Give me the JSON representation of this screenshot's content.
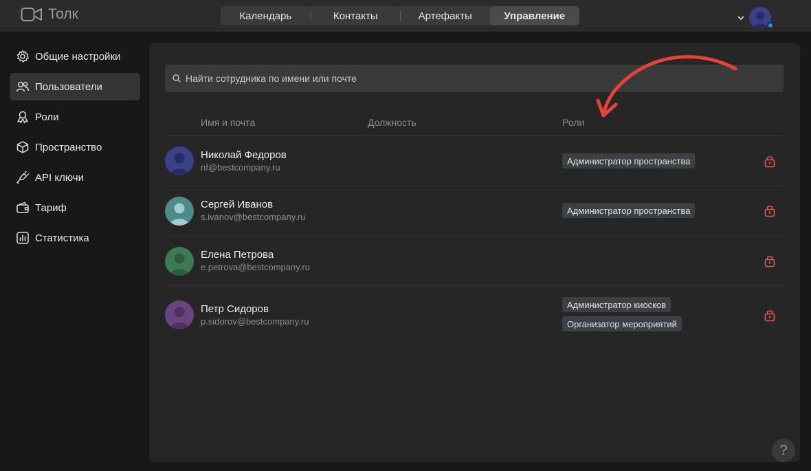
{
  "app": {
    "name": "Толк"
  },
  "nav": {
    "tabs": [
      "Календарь",
      "Контакты",
      "Артефакты",
      "Управление"
    ],
    "active": "Управление"
  },
  "sidebar": {
    "items": [
      {
        "label": "Общие настройки",
        "icon": "gear-icon"
      },
      {
        "label": "Пользователи",
        "icon": "users-icon",
        "active": true
      },
      {
        "label": "Роли",
        "icon": "roles-icon"
      },
      {
        "label": "Пространство",
        "icon": "cube-icon"
      },
      {
        "label": "API ключи",
        "icon": "plug-icon"
      },
      {
        "label": "Тариф",
        "icon": "wallet-icon"
      },
      {
        "label": "Статистика",
        "icon": "stats-icon"
      }
    ]
  },
  "search": {
    "placeholder": "Найти сотрудника по имени или почте"
  },
  "table": {
    "headers": {
      "name": "Имя и почта",
      "position": "Должность",
      "roles": "Роли"
    },
    "rows": [
      {
        "name": "Николай Федоров",
        "email": "nf@bestcompany.ru",
        "roles": [
          "Администратор пространства"
        ]
      },
      {
        "name": "Сергей Иванов",
        "email": "s.ivanov@bestcompany.ru",
        "roles": [
          "Администратор пространства"
        ]
      },
      {
        "name": "Елена Петрова",
        "email": "e.petrova@bestcompany.ru",
        "roles": []
      },
      {
        "name": "Петр Сидоров",
        "email": "p.sidorov@bestcompany.ru",
        "roles": [
          "Администратор киосков",
          "Организатор мероприятий"
        ]
      }
    ]
  },
  "help": {
    "label": "?"
  },
  "colors": {
    "accent": "#1f8bff",
    "lock": "#e05a5a",
    "annotation_arrow": "#e5423a"
  }
}
